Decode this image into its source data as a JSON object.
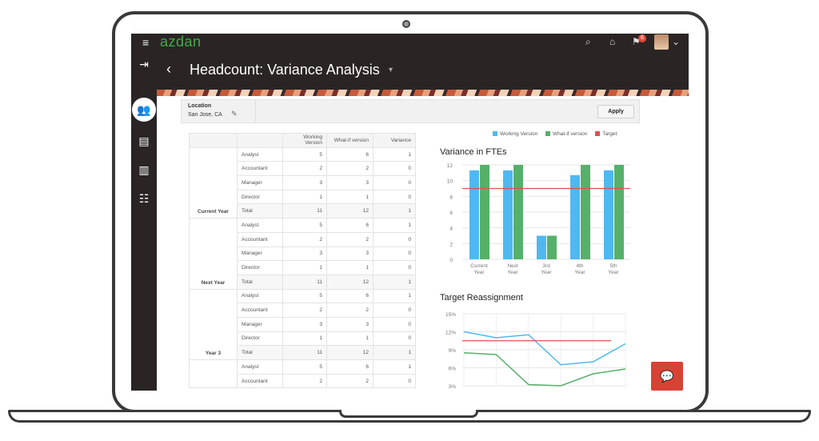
{
  "app": {
    "brand": "azdan",
    "notification_count": "6"
  },
  "page": {
    "title": "Headcount: Variance Analysis"
  },
  "filter": {
    "label": "Location",
    "value": "San Jose, CA",
    "apply_label": "Apply"
  },
  "table": {
    "headers": [
      "",
      "",
      "Working Version",
      "What-if version",
      "Variance"
    ],
    "groups": [
      {
        "name": "Current Year",
        "rows": [
          {
            "role": "Analyst",
            "working": "5",
            "whatif": "6",
            "variance": "1"
          },
          {
            "role": "Accountant",
            "working": "2",
            "whatif": "2",
            "variance": "0"
          },
          {
            "role": "Manager",
            "working": "3",
            "whatif": "3",
            "variance": "0"
          },
          {
            "role": "Director",
            "working": "1",
            "whatif": "1",
            "variance": "0"
          },
          {
            "role": "Total",
            "working": "11",
            "whatif": "12",
            "variance": "1"
          }
        ]
      },
      {
        "name": "Next Year",
        "rows": [
          {
            "role": "Analyst",
            "working": "5",
            "whatif": "6",
            "variance": "1"
          },
          {
            "role": "Accountant",
            "working": "2",
            "whatif": "2",
            "variance": "0"
          },
          {
            "role": "Manager",
            "working": "3",
            "whatif": "3",
            "variance": "0"
          },
          {
            "role": "Director",
            "working": "1",
            "whatif": "1",
            "variance": "0"
          },
          {
            "role": "Total",
            "working": "11",
            "whatif": "12",
            "variance": "1"
          }
        ]
      },
      {
        "name": "Year 3",
        "rows": [
          {
            "role": "Analyst",
            "working": "5",
            "whatif": "6",
            "variance": "1"
          },
          {
            "role": "Accountant",
            "working": "2",
            "whatif": "2",
            "variance": "0"
          },
          {
            "role": "Manager",
            "working": "3",
            "whatif": "3",
            "variance": "0"
          },
          {
            "role": "Director",
            "working": "1",
            "whatif": "1",
            "variance": "0"
          },
          {
            "role": "Total",
            "working": "11",
            "whatif": "12",
            "variance": "1"
          }
        ]
      },
      {
        "name": "",
        "rows": [
          {
            "role": "Analyst",
            "working": "5",
            "whatif": "6",
            "variance": "1"
          },
          {
            "role": "Accountant",
            "working": "2",
            "whatif": "2",
            "variance": "0"
          }
        ]
      }
    ]
  },
  "colors": {
    "working": "#4fb8f0",
    "whatif": "#56b06a",
    "target": "#e05050",
    "chrome": "#2a2524"
  },
  "legend": {
    "working": "Working Version",
    "whatif": "What-if version",
    "target": "Target"
  },
  "chart_data": [
    {
      "type": "bar",
      "title": "Variance in FTEs",
      "categories": [
        "Current Year",
        "Next Year",
        "3rd Year",
        "4th Year",
        "5th Year"
      ],
      "series": [
        {
          "name": "Working Version",
          "values": [
            11.3,
            11.3,
            3,
            10.7,
            11.3
          ]
        },
        {
          "name": "What-if version",
          "values": [
            12,
            12,
            3,
            12,
            12
          ]
        }
      ],
      "target": 9,
      "ylim": [
        0,
        12
      ],
      "yticks": [
        "0",
        "2",
        "4",
        "6",
        "8",
        "10",
        "12"
      ],
      "grid": true
    },
    {
      "type": "line",
      "title": "Target Reassignment",
      "x": [
        1,
        2,
        3,
        4,
        5,
        6
      ],
      "series": [
        {
          "name": "Working Version",
          "values": [
            12,
            11,
            11.5,
            6.5,
            7,
            10
          ]
        },
        {
          "name": "What-if version",
          "values": [
            8.5,
            8.2,
            3.2,
            3,
            5,
            5.8
          ]
        }
      ],
      "target": 10.5,
      "ylim": [
        3,
        15
      ],
      "yticks": [
        "3%",
        "6%",
        "9%",
        "12%",
        "15%"
      ],
      "grid": true
    }
  ]
}
